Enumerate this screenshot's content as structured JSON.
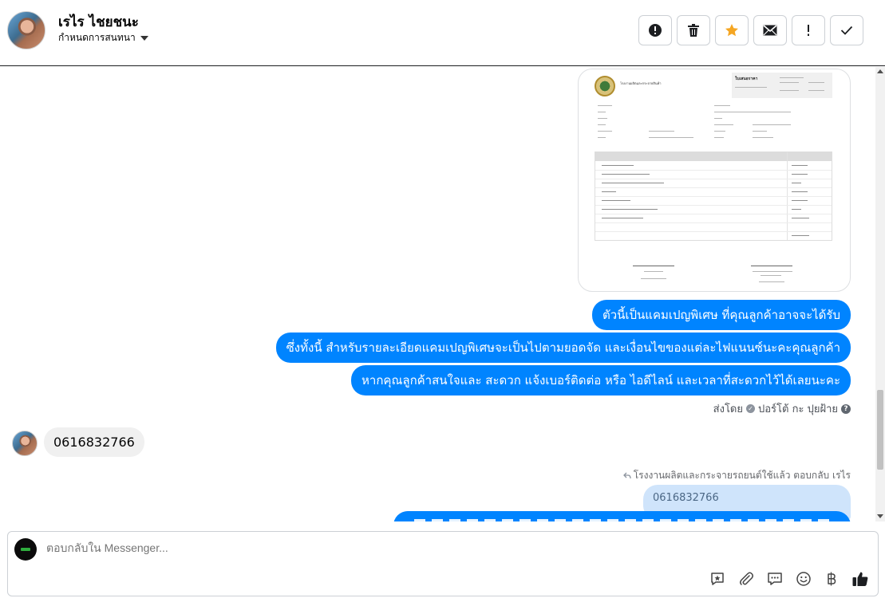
{
  "header": {
    "contact_name": "เรไร ไชยชนะ",
    "assign_label": "กำหนดการสนทนา",
    "actions": [
      {
        "name": "mark-spam-button",
        "icon": "alert-circle-icon"
      },
      {
        "name": "delete-button",
        "icon": "trash-icon"
      },
      {
        "name": "star-button",
        "icon": "star-icon",
        "color": "#f5a623"
      },
      {
        "name": "mark-unread-button",
        "icon": "envelope-icon"
      },
      {
        "name": "follow-up-button",
        "icon": "exclamation-icon"
      },
      {
        "name": "mark-done-button",
        "icon": "checkmark-icon"
      }
    ]
  },
  "chat": {
    "document_image": {
      "company_name": "โรงงานผลิตและกระจายสินค้า",
      "title": "ใบเสนอราคา"
    },
    "outgoing": [
      "ตัวนี้เป็นแคมเปญพิเศษ ที่คุณลูกค้าอาจจะได้รับ",
      "ซึ่งทั้งนี้ สำหรับรายละเอียดแคมเปญพิเศษจะเป็นไปตามยอดจัด และเงื่อนไขของแต่ละไฟแนนซ์นะคะคุณลูกค้า",
      "หากคุณลูกค้าสนใจและ สะดวก แจ้งเบอร์ติดต่อ หรือ ไอดีไลน์ และเวลาที่สะดวกไว้ได้เลยนะคะ"
    ],
    "sent_by_prefix": "ส่งโดย",
    "sent_by_name": "ปอร์โต้ กะ ปุยฝ้าย",
    "incoming_message": "0616832766",
    "reply_note": "โรงงานผลิตและกระจายรถยนต์ใช้แล้ว ตอบกลับ เรไร",
    "reply_quote": "0616832766"
  },
  "composer": {
    "placeholder": "ตอบกลับใน Messenger..."
  },
  "colors": {
    "accent": "#0084ff",
    "star": "#f5a623",
    "incoming_bubble": "#f0f0f0"
  }
}
